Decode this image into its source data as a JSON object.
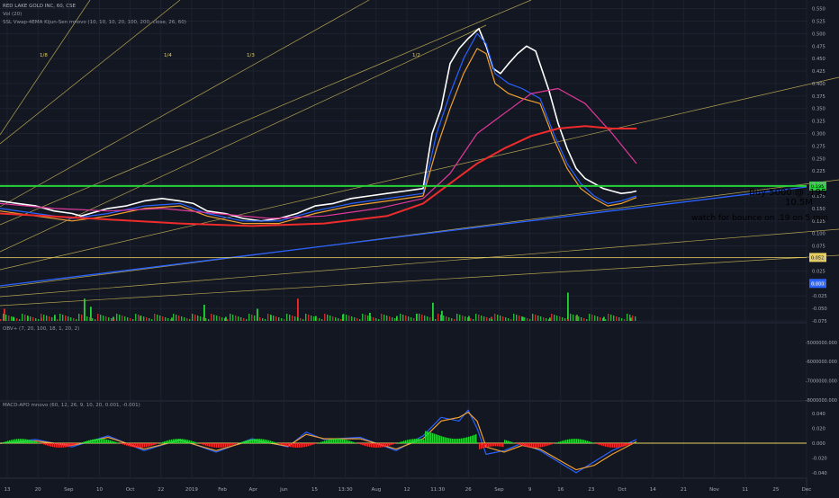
{
  "colors": {
    "background": "#131722",
    "grid": "#1e2230",
    "axis_text": "#a3a6af",
    "green": "#26d43a",
    "red": "#ef2b2b",
    "white": "#ffffff",
    "blue": "#2962ff",
    "orange": "#f0a030",
    "magenta": "#e0389a",
    "yellow": "#e8d060",
    "note_green": "#36e84a"
  },
  "header": {
    "symbol_line": "RED LAKE GOLD INC, 60, CSE",
    "vol_line": "Vol (20)",
    "ssl_line": "SSL Vwap-4EMA Kijun-Sen mnovo (10, 10, 10, 20, 100, 200, close, 26, 60)",
    "obv_line": "OBV+ (7, 20, 100, 18, 1, 20, 2)",
    "macd_line": "MACD-APO mnovo (60, 12, 26, 9, 10, 20, 0.001, -0.001)"
  },
  "annotations": {
    "buy": "Buy 5000 @ .195",
    "volume": "10.5M",
    "watch": "watch for bounce on .19 on 5 min",
    "fan_labels": [
      "1/8",
      "1/4",
      "1/3",
      "1/2"
    ]
  },
  "price_badges": {
    "current": "0.195",
    "level": "0.052",
    "vol_badge": "0.000"
  },
  "chart_data": {
    "type": "line",
    "title": "RED LAKE GOLD INC, 60, CSE",
    "x_ticks": [
      "13",
      "20",
      "Sep",
      "10",
      "Oct",
      "22",
      "2019",
      "Feb",
      "Apr",
      "Jun",
      "15",
      "13:30",
      "Aug",
      "12",
      "11:30",
      "26",
      "Sep",
      "9",
      "16",
      "23",
      "Oct",
      "14",
      "21",
      "Nov",
      "11",
      "25",
      "Dec"
    ],
    "price_axis": {
      "ticks": [
        "0.550",
        "0.525",
        "0.500",
        "0.475",
        "0.450",
        "0.425",
        "0.400",
        "0.375",
        "0.350",
        "0.325",
        "0.300",
        "0.275",
        "0.250",
        "0.225",
        "0.200",
        "0.175",
        "0.150",
        "0.125",
        "0.100",
        "0.075",
        "0.050",
        "0.025",
        "0.000",
        "-0.025",
        "-0.050",
        "-0.075"
      ],
      "range": [
        -0.075,
        0.56
      ]
    },
    "obv_axis": {
      "ticks": [
        "-5000000.000",
        "-6000000.000",
        "-7000000.000",
        "-8000000.000"
      ],
      "range": [
        -8000000,
        -4400000
      ]
    },
    "macd_axis": {
      "ticks": [
        "0.040",
        "0.020",
        "0.000",
        "-0.020",
        "-0.040"
      ],
      "range": [
        -0.045,
        0.05
      ]
    },
    "series": [
      {
        "role": "price",
        "color": "#ffffff",
        "x": [
          0,
          20,
          40,
          60,
          80,
          90,
          100,
          120,
          140,
          160,
          180,
          200,
          215,
          230,
          250,
          270,
          290,
          310,
          330,
          350,
          370,
          390,
          410,
          430,
          450,
          470,
          480,
          490,
          500,
          510,
          520,
          532,
          540,
          548,
          556,
          565,
          575,
          585,
          595,
          610,
          620,
          630,
          640,
          650,
          660,
          670,
          680,
          690,
          700,
          707
        ],
        "y": [
          0.165,
          0.16,
          0.155,
          0.145,
          0.14,
          0.135,
          0.14,
          0.15,
          0.155,
          0.165,
          0.17,
          0.165,
          0.16,
          0.145,
          0.14,
          0.13,
          0.125,
          0.13,
          0.14,
          0.155,
          0.16,
          0.17,
          0.175,
          0.18,
          0.185,
          0.19,
          0.3,
          0.35,
          0.44,
          0.47,
          0.49,
          0.51,
          0.475,
          0.43,
          0.42,
          0.44,
          0.46,
          0.475,
          0.465,
          0.385,
          0.32,
          0.27,
          0.23,
          0.21,
          0.2,
          0.19,
          0.185,
          0.18,
          0.182,
          0.185
        ]
      },
      {
        "role": "fast-ema",
        "color": "#2962ff",
        "x": [
          0,
          40,
          80,
          120,
          160,
          200,
          230,
          270,
          310,
          350,
          390,
          430,
          470,
          485,
          500,
          515,
          530,
          540,
          550,
          565,
          580,
          600,
          615,
          630,
          645,
          660,
          675,
          690,
          707
        ],
        "y": [
          0.15,
          0.14,
          0.13,
          0.14,
          0.155,
          0.16,
          0.14,
          0.125,
          0.125,
          0.145,
          0.16,
          0.17,
          0.18,
          0.3,
          0.38,
          0.45,
          0.5,
          0.48,
          0.42,
          0.4,
          0.39,
          0.37,
          0.3,
          0.24,
          0.2,
          0.175,
          0.16,
          0.165,
          0.175
        ]
      },
      {
        "role": "mid-ema",
        "color": "#f0a030",
        "x": [
          0,
          40,
          80,
          120,
          160,
          200,
          230,
          270,
          310,
          350,
          390,
          430,
          470,
          485,
          500,
          515,
          530,
          540,
          550,
          565,
          580,
          600,
          615,
          630,
          645,
          660,
          675,
          690,
          707
        ],
        "y": [
          0.145,
          0.135,
          0.125,
          0.135,
          0.15,
          0.155,
          0.135,
          0.12,
          0.12,
          0.14,
          0.155,
          0.165,
          0.175,
          0.27,
          0.35,
          0.42,
          0.47,
          0.46,
          0.4,
          0.38,
          0.37,
          0.36,
          0.29,
          0.23,
          0.19,
          0.17,
          0.155,
          0.16,
          0.172
        ]
      },
      {
        "role": "slow-ma",
        "color": "#e0389a",
        "x": [
          0,
          60,
          120,
          180,
          240,
          300,
          360,
          420,
          470,
          500,
          530,
          560,
          590,
          620,
          650,
          680,
          707
        ],
        "y": [
          0.16,
          0.15,
          0.145,
          0.15,
          0.14,
          0.13,
          0.135,
          0.15,
          0.17,
          0.22,
          0.3,
          0.34,
          0.38,
          0.39,
          0.36,
          0.3,
          0.24
        ]
      },
      {
        "role": "long-ma",
        "color": "#ef2b2b",
        "x": [
          0,
          100,
          200,
          280,
          360,
          430,
          470,
          500,
          530,
          560,
          590,
          620,
          650,
          680,
          707
        ],
        "y": [
          0.14,
          0.13,
          0.12,
          0.115,
          0.12,
          0.135,
          0.16,
          0.2,
          0.24,
          0.27,
          0.295,
          0.31,
          0.315,
          0.31,
          0.31
        ]
      },
      {
        "role": "macd",
        "color": "#2962ff",
        "x": [
          0,
          40,
          80,
          120,
          160,
          200,
          240,
          280,
          320,
          340,
          360,
          400,
          440,
          470,
          490,
          510,
          520,
          530,
          540,
          560,
          580,
          600,
          620,
          640,
          660,
          680,
          707
        ],
        "y": [
          0.0,
          0.005,
          -0.005,
          0.01,
          -0.01,
          0.005,
          -0.012,
          0.006,
          -0.005,
          0.015,
          0.005,
          0.008,
          -0.01,
          0.01,
          0.035,
          0.03,
          0.045,
          0.02,
          -0.015,
          -0.01,
          0.0,
          -0.01,
          -0.025,
          -0.04,
          -0.025,
          -0.01,
          0.005
        ]
      },
      {
        "role": "signal",
        "color": "#f0a030",
        "x": [
          0,
          40,
          80,
          120,
          160,
          200,
          240,
          280,
          320,
          340,
          360,
          400,
          440,
          470,
          490,
          510,
          520,
          530,
          540,
          560,
          580,
          600,
          620,
          640,
          660,
          680,
          707
        ],
        "y": [
          0.0,
          0.003,
          -0.003,
          0.008,
          -0.008,
          0.004,
          -0.01,
          0.004,
          -0.004,
          0.012,
          0.006,
          0.006,
          -0.008,
          0.006,
          0.03,
          0.035,
          0.042,
          0.03,
          -0.005,
          -0.012,
          -0.003,
          -0.008,
          -0.022,
          -0.036,
          -0.03,
          -0.015,
          0.002
        ]
      }
    ],
    "levels": [
      {
        "name": "support",
        "value": 0.195,
        "color": "#26d43a"
      },
      {
        "name": "low-level",
        "value": 0.052,
        "color": "#e8d060"
      }
    ],
    "volume_bars": [
      {
        "x": 4,
        "h": 0.3,
        "dir": "down"
      },
      {
        "x": 14,
        "h": 0.1,
        "dir": "up"
      },
      {
        "x": 30,
        "h": 0.12,
        "dir": "up"
      },
      {
        "x": 45,
        "h": 0.08,
        "dir": "down"
      },
      {
        "x": 60,
        "h": 0.15,
        "dir": "up"
      },
      {
        "x": 93,
        "h": 0.55,
        "dir": "up"
      },
      {
        "x": 100,
        "h": 0.35,
        "dir": "up"
      },
      {
        "x": 125,
        "h": 0.1,
        "dir": "up"
      },
      {
        "x": 155,
        "h": 0.12,
        "dir": "down"
      },
      {
        "x": 190,
        "h": 0.08,
        "dir": "up"
      },
      {
        "x": 226,
        "h": 0.4,
        "dir": "up"
      },
      {
        "x": 250,
        "h": 0.1,
        "dir": "up"
      },
      {
        "x": 285,
        "h": 0.3,
        "dir": "up"
      },
      {
        "x": 300,
        "h": 0.14,
        "dir": "up"
      },
      {
        "x": 330,
        "h": 0.55,
        "dir": "down"
      },
      {
        "x": 350,
        "h": 0.12,
        "dir": "up"
      },
      {
        "x": 380,
        "h": 0.16,
        "dir": "up"
      },
      {
        "x": 410,
        "h": 0.2,
        "dir": "up"
      },
      {
        "x": 440,
        "h": 0.12,
        "dir": "up"
      },
      {
        "x": 462,
        "h": 0.18,
        "dir": "up"
      },
      {
        "x": 480,
        "h": 0.45,
        "dir": "up"
      },
      {
        "x": 490,
        "h": 0.25,
        "dir": "up"
      },
      {
        "x": 520,
        "h": 0.12,
        "dir": "up"
      },
      {
        "x": 545,
        "h": 0.1,
        "dir": "down"
      },
      {
        "x": 580,
        "h": 0.1,
        "dir": "up"
      },
      {
        "x": 610,
        "h": 0.08,
        "dir": "up"
      },
      {
        "x": 630,
        "h": 0.7,
        "dir": "up"
      },
      {
        "x": 640,
        "h": 0.15,
        "dir": "up"
      },
      {
        "x": 670,
        "h": 0.1,
        "dir": "up"
      },
      {
        "x": 700,
        "h": 0.08,
        "dir": "up"
      }
    ]
  }
}
